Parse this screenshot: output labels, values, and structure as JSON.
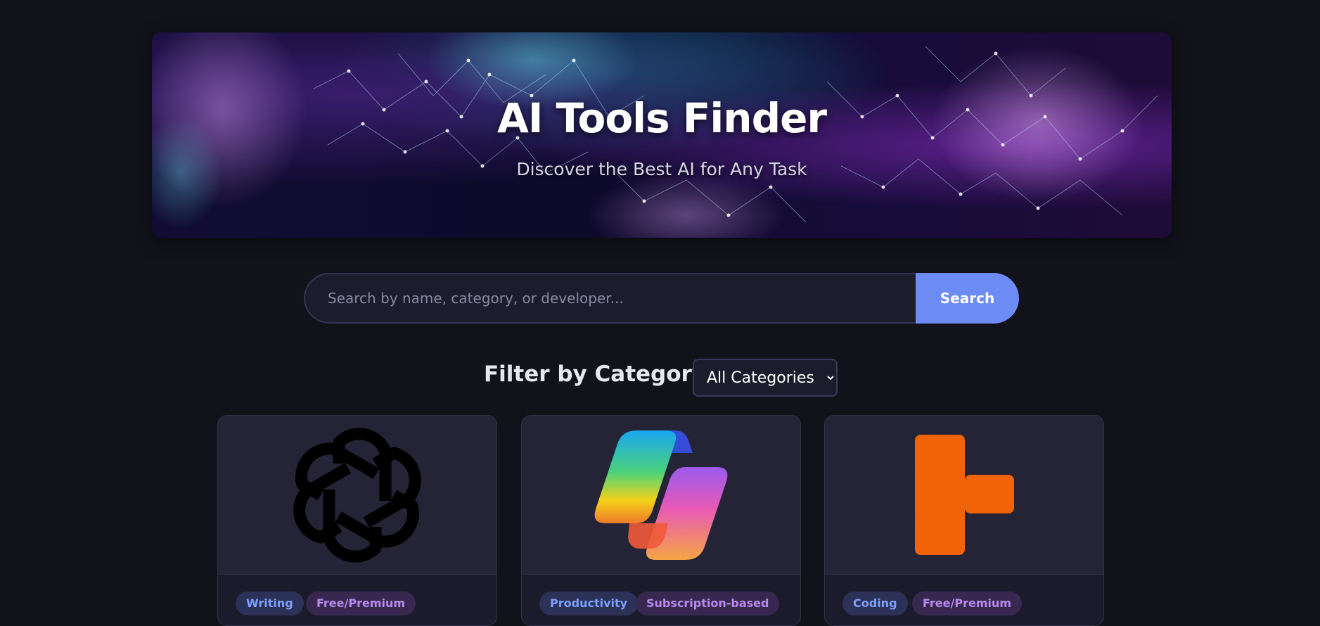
{
  "hero": {
    "title": "AI Tools Finder",
    "subtitle": "Discover the Best AI for Any Task"
  },
  "search": {
    "placeholder": "Search by name, category, or developer...",
    "value": "",
    "button_label": "Search"
  },
  "filter": {
    "label": "Filter by Category:",
    "selected": "All Categories"
  },
  "cards": [
    {
      "logo": "openai-logo-icon",
      "category": "Writing",
      "pricing": "Free/Premium"
    },
    {
      "logo": "copilot-logo-icon",
      "category": "Productivity",
      "pricing": "Subscription-based"
    },
    {
      "logo": "replit-logo-icon",
      "category": "Coding",
      "pricing": "Free/Premium"
    }
  ],
  "colors": {
    "background": "#12121b",
    "accent": "#6c8bf5",
    "card": "#242436",
    "category_tag_text": "#7ea0ff",
    "pricing_tag_text": "#b98af0",
    "replit_orange": "#f26207"
  }
}
